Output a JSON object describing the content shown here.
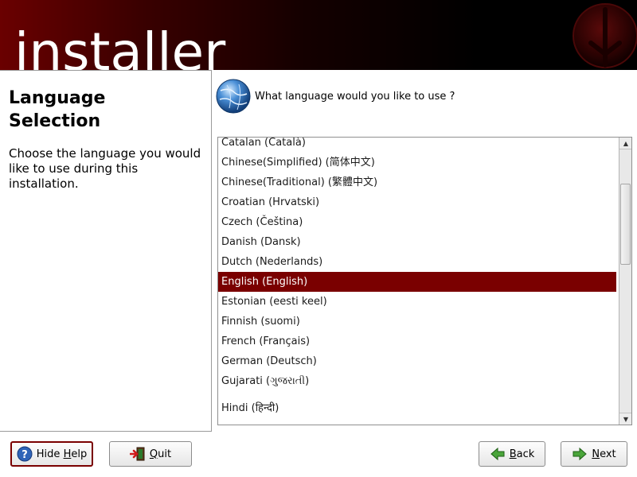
{
  "banner": {
    "title": "installer"
  },
  "help": {
    "title": "Language Selection",
    "text": "Choose the language you would like to use during this installation."
  },
  "prompt": "What language would you like to use ?",
  "languages": [
    "Catalan (Català)",
    "Chinese(Simplified) (简体中文)",
    "Chinese(Traditional) (繁體中文)",
    "Croatian (Hrvatski)",
    "Czech (Čeština)",
    "Danish (Dansk)",
    "Dutch (Nederlands)",
    "English (English)",
    "Estonian (eesti keel)",
    "Finnish (suomi)",
    "French (Français)",
    "German (Deutsch)",
    "Gujarati (ગુજરાતી)",
    "Hindi (हिन्दी)"
  ],
  "selected_language": "English (English)",
  "buttons": {
    "hide_help": {
      "pre": "Hide ",
      "mnemonic": "H",
      "post": "elp"
    },
    "quit": {
      "pre": "",
      "mnemonic": "Q",
      "post": "uit"
    },
    "back": {
      "pre": "",
      "mnemonic": "B",
      "post": "ack"
    },
    "next": {
      "pre": "",
      "mnemonic": "N",
      "post": "ext"
    }
  },
  "colors": {
    "accent": "#7a0000",
    "banner_dark": "#000000"
  }
}
